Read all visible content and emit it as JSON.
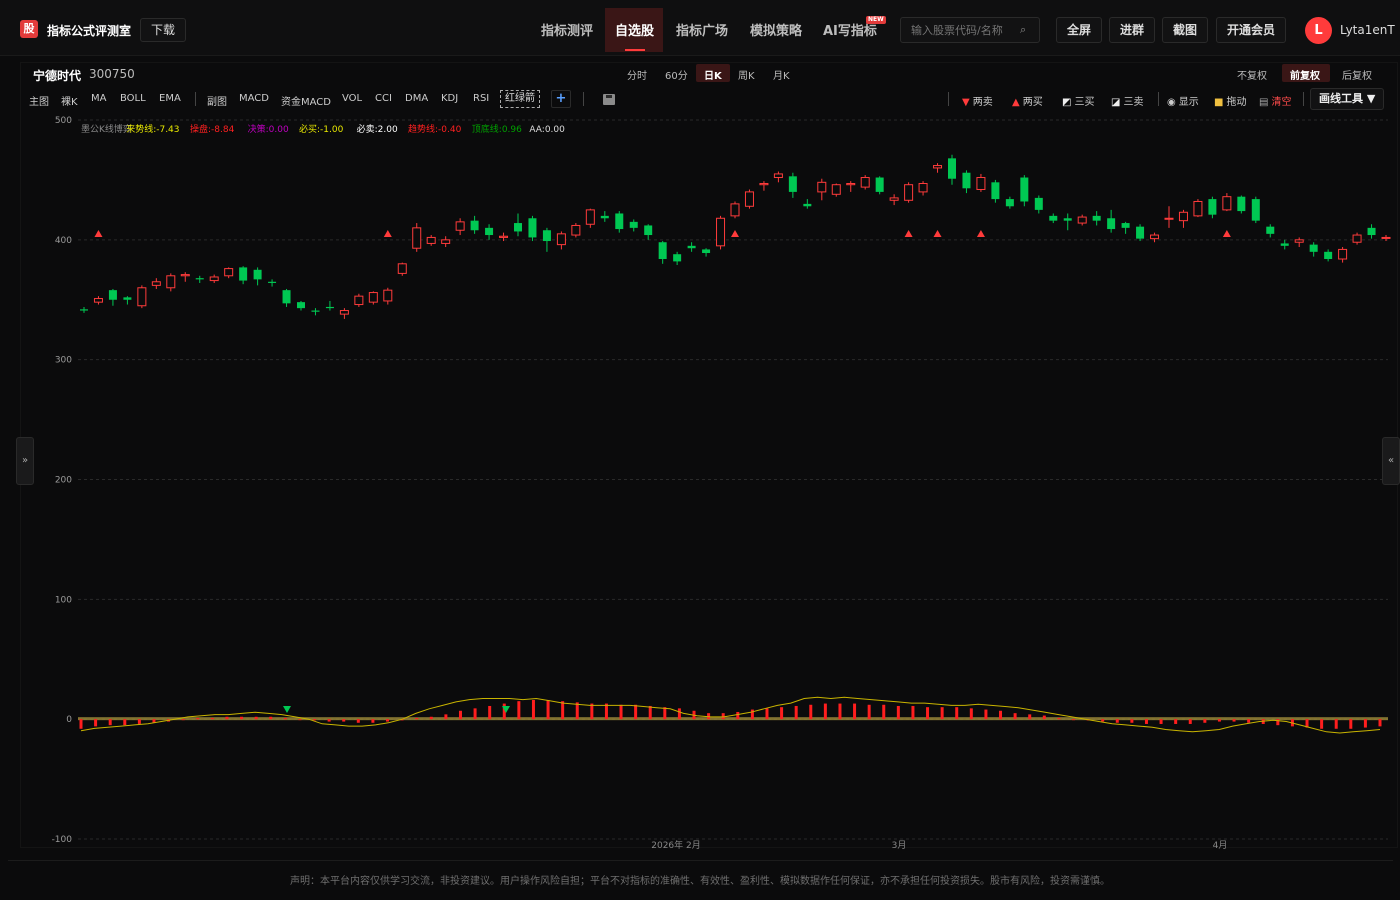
{
  "app": {
    "logo_char": "股",
    "brand": "指标公式评测室",
    "download_label": "下载"
  },
  "nav": {
    "items": [
      "指标测评",
      "自选股",
      "指标广场",
      "模拟策略",
      "AI写指标"
    ],
    "active": "自选股",
    "new_badge": "NEW"
  },
  "search": {
    "placeholder": "输入股票代码/名称"
  },
  "toolbar": {
    "fullscreen": "全屏",
    "join_group": "进群",
    "screenshot": "截图",
    "membership": "开通会员"
  },
  "user": {
    "avatar_letter": "L",
    "name": "Lyta1enT"
  },
  "stock": {
    "name": "宁德时代",
    "code": "300750"
  },
  "periods": [
    "分时",
    "60分",
    "日K",
    "周K",
    "月K"
  ],
  "active_period": "日K",
  "adjust": [
    "不复权",
    "前复权",
    "后复权"
  ],
  "active_adjust": "前复权",
  "indicators_main": [
    "主图",
    "裸K",
    "MA",
    "BOLL",
    "EMA"
  ],
  "indicators_sub": [
    "副图",
    "MACD",
    "资金MACD",
    "VOL",
    "CCI",
    "DMA",
    "KDJ",
    "RSI"
  ],
  "hongluo": "红绿箭",
  "plus": "+",
  "tools": {
    "two_sell": "两卖",
    "two_buy": "两买",
    "three_buy": "三买",
    "three_sell": "三卖",
    "show": "显示",
    "drag": "拖动",
    "clear": "清空",
    "draw_tool": "画线工具 ▼"
  },
  "legend": [
    {
      "text": "墨公K线博弈",
      "color": "#888888"
    },
    {
      "text": "来势线:-7.43",
      "color": "#e8e800"
    },
    {
      "text": "操盘:-8.84",
      "color": "#ff2020"
    },
    {
      "text": "决策:0.00",
      "color": "#c000c0"
    },
    {
      "text": "必买:-1.00",
      "color": "#e8e800"
    },
    {
      "text": "必卖:2.00",
      "color": "#ffffff"
    },
    {
      "text": "趋势线:-0.40",
      "color": "#ff2020"
    },
    {
      "text": "顶底线:0.96",
      "color": "#00a000"
    },
    {
      "text": "AA:0.00",
      "color": "#dddddd"
    }
  ],
  "side_left": "»",
  "side_right": "«",
  "disclaimer": "声明：本平台内容仅供学习交流，非投资建议。用户操作风险自担；平台不对指标的准确性、有效性、盈利性、模拟数据作任何保证，亦不承担任何投资损失。股市有风险，投资需谨慎。",
  "chart_data": {
    "type": "candlestick",
    "y_ticks": [
      500,
      400,
      300,
      200,
      100,
      0,
      -100
    ],
    "ylim": [
      -100,
      500
    ],
    "x_labels": [
      "2026年 2月",
      "3月",
      "4月"
    ],
    "colors": {
      "up": "#ff3b3b",
      "down": "#00c853",
      "line": "#c8b400"
    },
    "candles": [
      [
        342,
        341,
        344,
        339
      ],
      [
        348,
        351,
        353,
        346
      ],
      [
        358,
        350,
        359,
        345
      ],
      [
        352,
        350,
        353,
        346
      ],
      [
        345,
        360,
        362,
        343
      ],
      [
        362,
        365,
        368,
        359
      ],
      [
        360,
        370,
        372,
        357
      ],
      [
        370,
        371,
        373,
        365
      ],
      [
        368,
        367,
        370,
        364
      ],
      [
        366,
        369,
        371,
        364
      ],
      [
        370,
        376,
        377,
        368
      ],
      [
        377,
        366,
        378,
        363
      ],
      [
        375,
        367,
        377,
        362
      ],
      [
        365,
        364,
        367,
        361
      ],
      [
        358,
        347,
        359,
        344
      ],
      [
        348,
        343,
        349,
        341
      ],
      [
        341,
        340,
        343,
        337
      ],
      [
        344,
        343,
        349,
        341
      ],
      [
        338,
        341,
        343,
        334
      ],
      [
        346,
        353,
        355,
        344
      ],
      [
        348,
        356,
        357,
        346
      ],
      [
        349,
        358,
        360,
        346
      ],
      [
        372,
        380,
        381,
        370
      ],
      [
        393,
        410,
        414,
        390
      ],
      [
        397,
        402,
        404,
        395
      ],
      [
        397,
        400,
        403,
        394
      ],
      [
        408,
        415,
        418,
        404
      ],
      [
        416,
        408,
        420,
        405
      ],
      [
        410,
        404,
        413,
        400
      ],
      [
        402,
        403,
        406,
        399
      ],
      [
        414,
        407,
        422,
        403
      ],
      [
        418,
        402,
        420,
        399
      ],
      [
        408,
        399,
        410,
        390
      ],
      [
        396,
        405,
        407,
        392
      ],
      [
        404,
        412,
        414,
        402
      ],
      [
        413,
        425,
        426,
        410
      ],
      [
        420,
        418,
        424,
        415
      ],
      [
        422,
        409,
        424,
        406
      ],
      [
        415,
        410,
        417,
        407
      ],
      [
        412,
        404,
        413,
        400
      ],
      [
        398,
        384,
        399,
        380
      ],
      [
        388,
        382,
        390,
        379
      ],
      [
        395,
        393,
        398,
        390
      ],
      [
        392,
        389,
        393,
        386
      ],
      [
        395,
        418,
        420,
        392
      ],
      [
        420,
        430,
        432,
        418
      ],
      [
        428,
        440,
        442,
        426
      ],
      [
        446,
        447,
        449,
        441
      ],
      [
        452,
        455,
        457,
        448
      ],
      [
        453,
        440,
        456,
        435
      ],
      [
        430,
        428,
        434,
        426
      ],
      [
        440,
        448,
        451,
        433
      ],
      [
        438,
        446,
        447,
        436
      ],
      [
        446,
        447,
        449,
        440
      ],
      [
        444,
        452,
        454,
        442
      ],
      [
        452,
        440,
        453,
        438
      ],
      [
        433,
        435,
        438,
        429
      ],
      [
        433,
        446,
        448,
        431
      ],
      [
        440,
        447,
        449,
        437
      ],
      [
        460,
        462,
        464,
        456
      ],
      [
        468,
        451,
        471,
        446
      ],
      [
        456,
        443,
        458,
        439
      ],
      [
        442,
        452,
        455,
        440
      ],
      [
        448,
        434,
        450,
        431
      ],
      [
        434,
        428,
        436,
        426
      ],
      [
        452,
        432,
        454,
        428
      ],
      [
        435,
        425,
        437,
        422
      ],
      [
        420,
        416,
        422,
        414
      ],
      [
        418,
        416,
        422,
        408
      ],
      [
        414,
        419,
        421,
        412
      ],
      [
        420,
        416,
        424,
        412
      ],
      [
        418,
        409,
        425,
        406
      ],
      [
        414,
        410,
        415,
        405
      ],
      [
        411,
        401,
        413,
        399
      ],
      [
        401,
        404,
        406,
        398
      ],
      [
        418,
        418,
        428,
        410
      ],
      [
        416,
        423,
        425,
        410
      ],
      [
        420,
        432,
        434,
        419
      ],
      [
        434,
        421,
        436,
        418
      ],
      [
        425,
        436,
        439,
        424
      ],
      [
        436,
        424,
        437,
        422
      ],
      [
        434,
        416,
        436,
        414
      ],
      [
        411,
        405,
        413,
        402
      ],
      [
        397,
        395,
        400,
        392
      ],
      [
        398,
        400,
        402,
        394
      ],
      [
        396,
        390,
        398,
        386
      ],
      [
        390,
        384,
        392,
        382
      ],
      [
        384,
        392,
        394,
        381
      ],
      [
        398,
        404,
        406,
        396
      ],
      [
        410,
        404,
        413,
        401
      ],
      [
        402,
        402,
        404,
        399
      ]
    ],
    "macd_hist": [
      -8,
      -6,
      -5,
      -5,
      -4,
      -3,
      -2,
      0,
      1,
      1,
      2,
      2,
      2,
      2,
      1,
      0,
      -1,
      -2,
      -2,
      -3,
      -3,
      -2,
      -1,
      1,
      2,
      4,
      7,
      9,
      11,
      13,
      15,
      16,
      16,
      15,
      14,
      13,
      13,
      12,
      12,
      11,
      10,
      9,
      7,
      5,
      5,
      6,
      8,
      9,
      10,
      11,
      12,
      13,
      13,
      13,
      12,
      12,
      11,
      11,
      10,
      10,
      10,
      9,
      8,
      7,
      5,
      4,
      3,
      1,
      0,
      -1,
      -2,
      -3,
      -3,
      -4,
      -4,
      -4,
      -4,
      -3,
      -2,
      -2,
      -3,
      -4,
      -5,
      -6,
      -7,
      -8,
      -8,
      -8,
      -7,
      -6
    ],
    "macd_line": [
      -10,
      -8,
      -7,
      -6,
      -5,
      -4,
      -2,
      0,
      2,
      3,
      4,
      4,
      5,
      6,
      5,
      4,
      2,
      0,
      -4,
      -5,
      -6,
      -6,
      -5,
      -3,
      0,
      5,
      9,
      12,
      15,
      17,
      18,
      18,
      18,
      17,
      18,
      16,
      14,
      13,
      12,
      12,
      12,
      12,
      11,
      10,
      9,
      5,
      3,
      2,
      2,
      4,
      6,
      9,
      12,
      14,
      18,
      19,
      18,
      19,
      18,
      17,
      16,
      15,
      14,
      14,
      13,
      12,
      12,
      13,
      12,
      11,
      10,
      8,
      6,
      4,
      2,
      0,
      -2,
      -4,
      -5,
      -6,
      -7,
      -9,
      -10,
      -11,
      -10,
      -9,
      -6,
      -4,
      -2,
      -1,
      -2,
      -5,
      -8,
      -11,
      -12,
      -11,
      -10,
      -9
    ]
  }
}
